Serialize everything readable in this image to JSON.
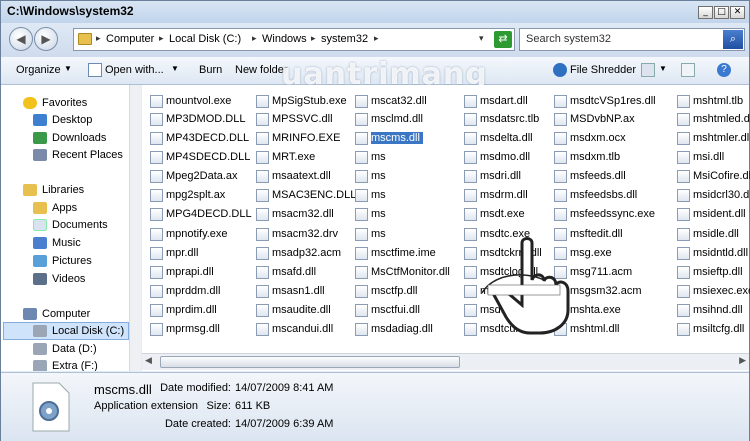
{
  "window": {
    "title": "C:\\Windows\\system32"
  },
  "address": {
    "crumbs": [
      "Computer",
      "Local Disk (C:)",
      "Windows",
      "system32"
    ]
  },
  "search": {
    "placeholder": "Search system32"
  },
  "toolbar": {
    "organize": "Organize",
    "open_with": "Open with...",
    "burn": "Burn",
    "new_folder": "New folder",
    "file_shredder": "File Shredder"
  },
  "watermark": "uantrimang",
  "sidebar": {
    "favorites": "Favorites",
    "desktop": "Desktop",
    "downloads": "Downloads",
    "recent_places": "Recent Places",
    "libraries": "Libraries",
    "apps": "Apps",
    "documents": "Documents",
    "music": "Music",
    "pictures": "Pictures",
    "videos": "Videos",
    "computer": "Computer",
    "local_disk": "Local Disk (C:)",
    "data": "Data (D:)",
    "extra": "Extra (F:)"
  },
  "files": [
    [
      "mountvol.exe",
      "MP3DMOD.DLL",
      "MP43DECD.DLL",
      "MP4SDECD.DLL",
      "Mpeg2Data.ax",
      "mpg2splt.ax",
      "MPG4DECD.DLL",
      "mpnotify.exe",
      "mpr.dll",
      "mprapi.dll",
      "mprddm.dll",
      "mprdim.dll",
      "mprmsg.dll"
    ],
    [
      "MpSigStub.exe",
      "MPSSVC.dll",
      "MRINFO.EXE",
      "MRT.exe",
      "msaatext.dll",
      "MSAC3ENC.DLL",
      "msacm32.dll",
      "msacm32.drv",
      "msadp32.acm",
      "msafd.dll",
      "msasn1.dll",
      "msaudite.dll",
      "mscandui.dll"
    ],
    [
      "mscat32.dll",
      "msclmd.dll",
      "mscms.dll",
      "msconfig.exe",
      "msctf.dll",
      "msctfime.ime",
      "msctfmonitor.dll",
      "msctfp.dll",
      "msctfui.dll",
      "msdadiag.dll"
    ],
    [
      "msdart.dll",
      "msdatsrc.tlb",
      "msdelta.dll",
      "msdmo.dll",
      "msdri.dll",
      "msdrm.dll",
      "msdt.exe",
      "msdtc.exe",
      "msdtckrm.dll",
      "msdtclog.dll",
      "msdtcprx.dll",
      "msdtctm.dll",
      "msdtcuiu.dll"
    ],
    [
      "msdtcVSp1res.dll",
      "MSDvbNP.ax",
      "msdxm.ocx",
      "msdxm.tlb",
      "msfeeds.dll",
      "msfeedsbs.dll",
      "msfeedssync.exe",
      "msftedit.dll",
      "msg.exe",
      "msg711.acm",
      "msgsm32.acm",
      "mshta.exe",
      "mshtml.dll"
    ],
    [
      "mshtml.tlb",
      "mshtmled.dll",
      "mshtmler.dll",
      "msi.dll",
      "MsiCofire.dll",
      "msidcrl30.dll",
      "msident.dll",
      "msidle.dll",
      "msidntld.dll",
      "msieftp.dll",
      "msiexec.exe",
      "msihnd.dll",
      "msiltcfg.dll"
    ]
  ],
  "col3_visible": [
    "mscat32.dll",
    "msclmd.dll",
    "mscms.dll",
    "ms",
    "ms",
    "ms",
    "ms",
    "ms",
    "msctfime.ime",
    "MsCtfMonitor.dll",
    "msctfp.dll",
    "msctfui.dll",
    "msdadiag.dll"
  ],
  "selected_file": "mscms.dll",
  "details": {
    "name": "mscms.dll",
    "type": "Application extension",
    "modified_label": "Date modified:",
    "modified": "14/07/2009 8:41 AM",
    "size_label": "Size:",
    "size": "611 KB",
    "created_label": "Date created:",
    "created": "14/07/2009 6:39 AM"
  },
  "colors": {
    "selection": "#3a76c4",
    "accent": "#1f4fa0"
  }
}
